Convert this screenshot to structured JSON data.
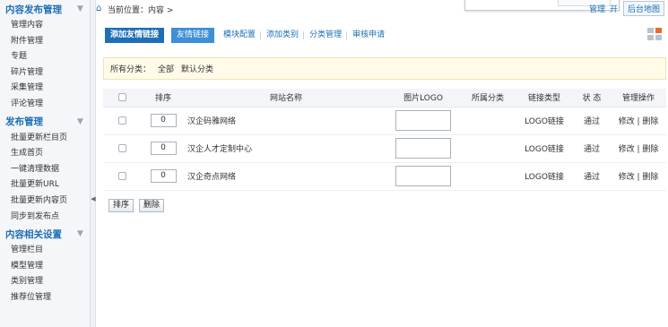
{
  "sidebar": {
    "sections": [
      {
        "title": "内容发布管理",
        "items": [
          "管理内容",
          "附件管理",
          "专题",
          "碎片管理",
          "采集管理",
          "评论管理"
        ]
      },
      {
        "title": "发布管理",
        "items": [
          "批量更新栏目页",
          "生成首页",
          "一键清理数据",
          "批量更新URL",
          "批量更新内容页",
          "同步到发布点"
        ]
      },
      {
        "title": "内容相关设置",
        "items": [
          "管理栏目",
          "模型管理",
          "类别管理",
          "推荐位管理"
        ]
      }
    ]
  },
  "breadcrumb": {
    "label": "当前位置：",
    "path": "内容 >"
  },
  "topright": {
    "links": [
      "管理",
      "开"
    ],
    "button": "后台地图"
  },
  "tabs": [
    {
      "label": "添加友情链接",
      "kind": "primary"
    },
    {
      "label": "友情链接",
      "kind": "active"
    },
    {
      "label": "模块配置",
      "kind": "normal"
    },
    {
      "label": "添加类别",
      "kind": "normal"
    },
    {
      "label": "分类管理",
      "kind": "normal"
    },
    {
      "label": "审核申请",
      "kind": "normal"
    }
  ],
  "filter": {
    "label": "所有分类：",
    "options": [
      "全部",
      "默认分类"
    ]
  },
  "table": {
    "headers": [
      "",
      "排序",
      "网站名称",
      "图片LOGO",
      "所属分类",
      "链接类型",
      "状 态",
      "管理操作"
    ],
    "rows": [
      {
        "order": "0",
        "name": "汉企码雅网络",
        "category": "",
        "type": "LOGO链接",
        "status": "通过",
        "edit": "修改",
        "delete": "删除"
      },
      {
        "order": "0",
        "name": "汉企人才定制中心",
        "category": "",
        "type": "LOGO链接",
        "status": "通过",
        "edit": "修改",
        "delete": "删除"
      },
      {
        "order": "0",
        "name": "汉企奇点网络",
        "category": "",
        "type": "LOGO链接",
        "status": "通过",
        "edit": "修改",
        "delete": "删除"
      }
    ]
  },
  "actions": {
    "sort": "排序",
    "delete": "删除"
  },
  "colors": {
    "accent": "#1e6fb5",
    "filter_bg": "#fffbe8"
  }
}
